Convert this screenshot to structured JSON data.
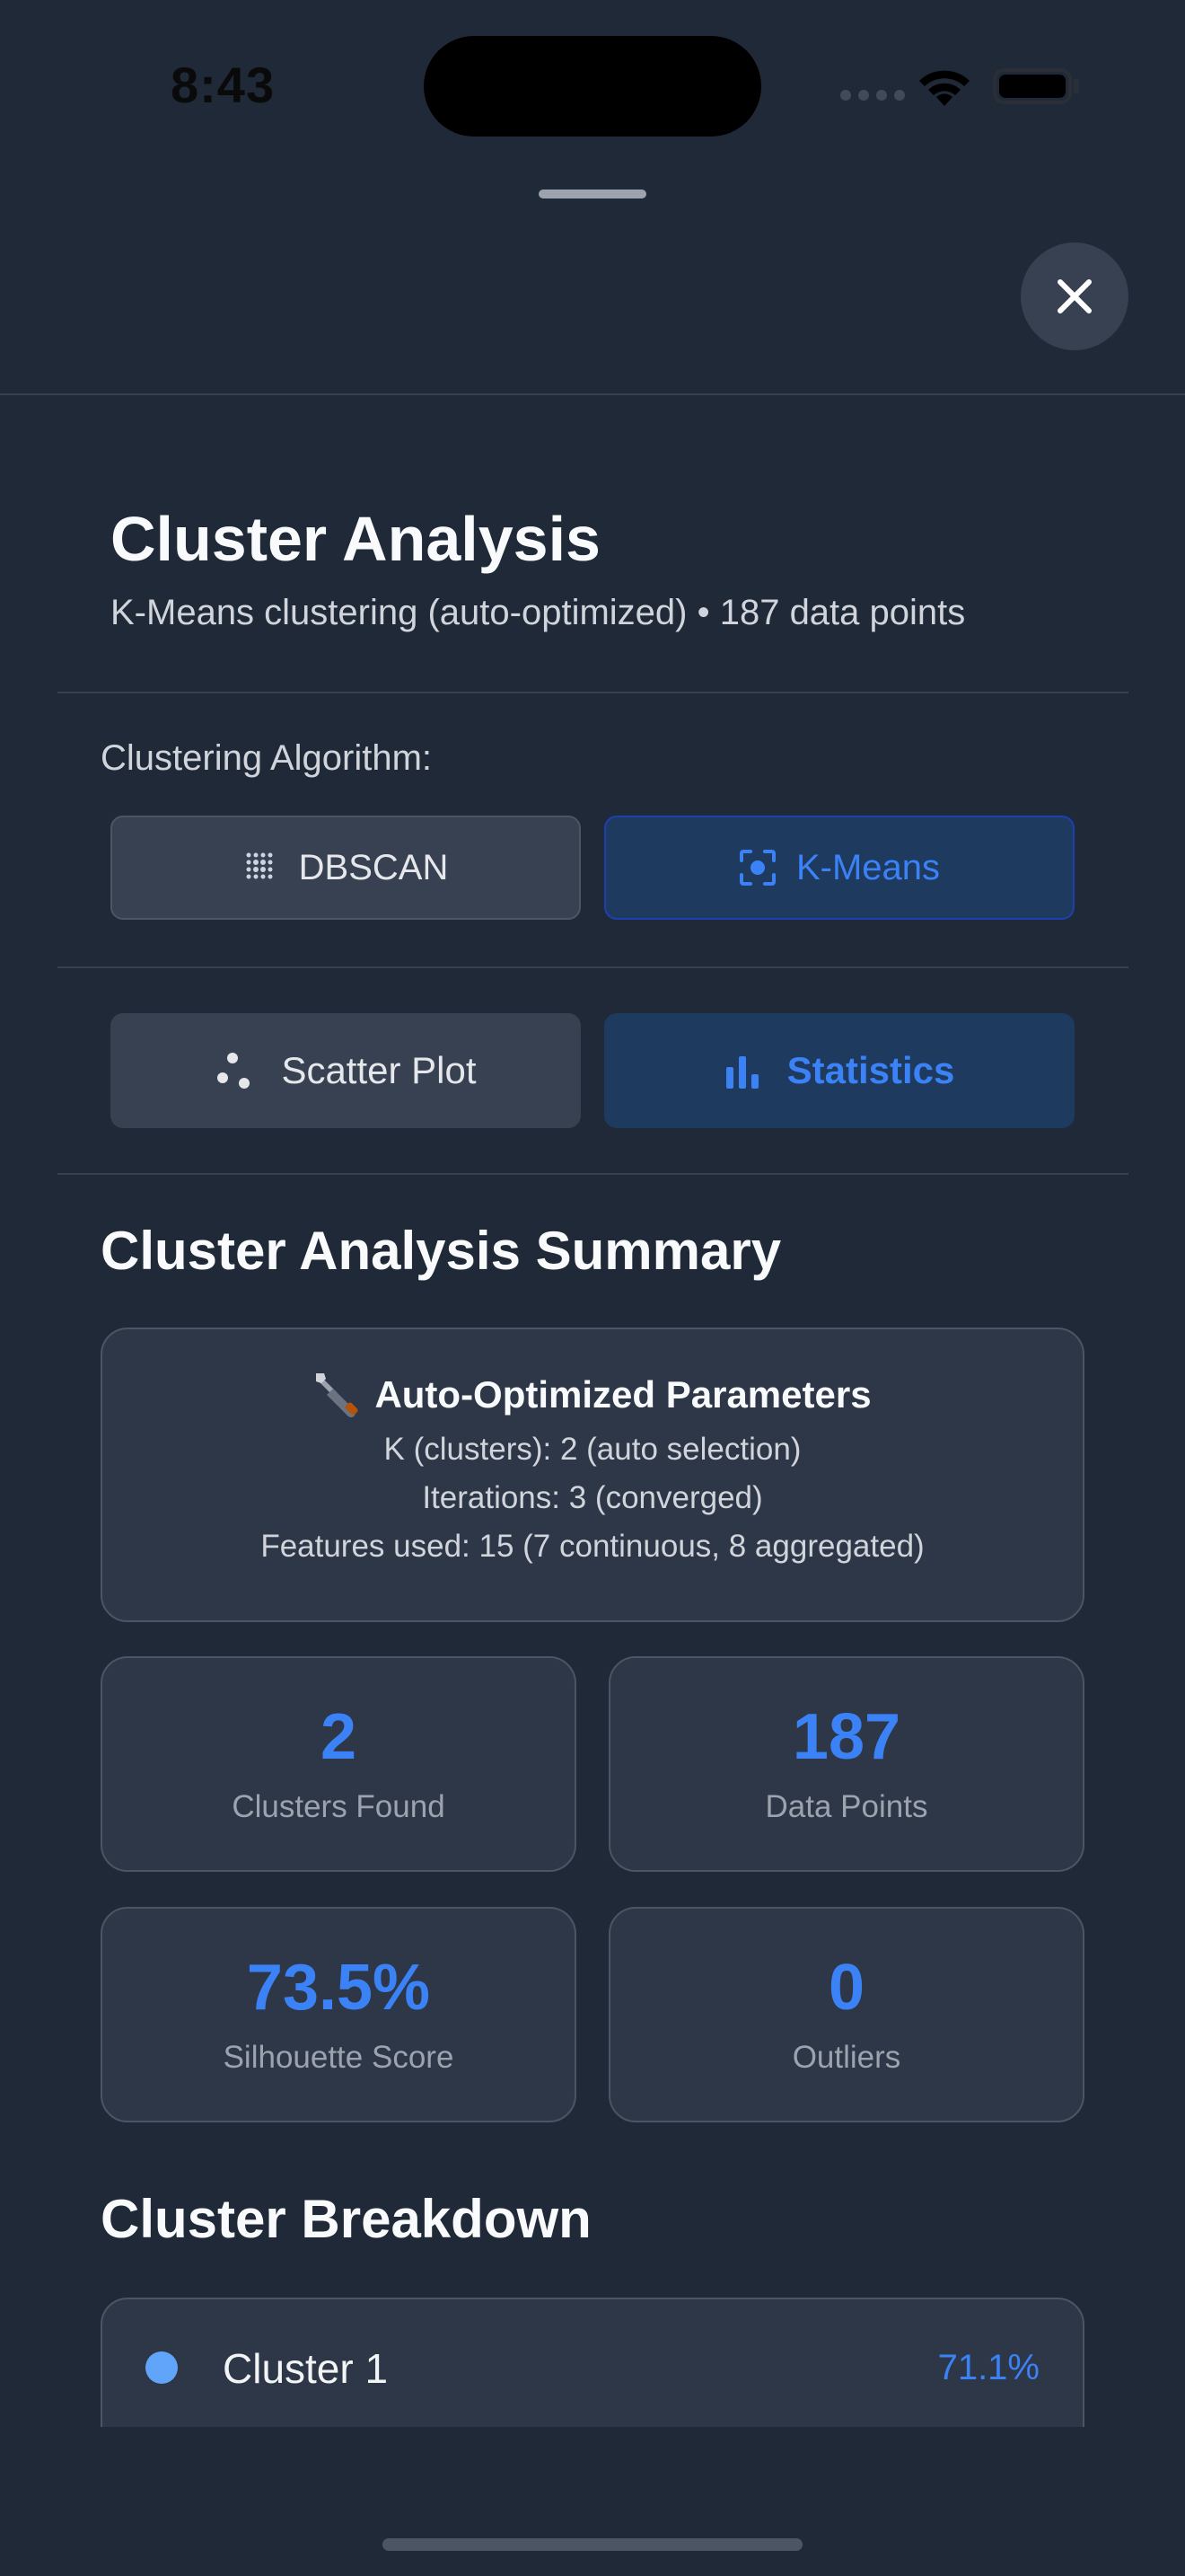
{
  "status_bar": {
    "time": "8:43"
  },
  "header": {
    "close_icon": "close-x-icon"
  },
  "page": {
    "title": "Cluster Analysis",
    "subtitle": "K-Means clustering (auto-optimized) • 187 data points"
  },
  "algorithm": {
    "label": "Clustering Algorithm:",
    "options": [
      {
        "label": "DBSCAN",
        "icon": "dot-grid-icon",
        "selected": false
      },
      {
        "label": "K-Means",
        "icon": "focus-target-icon",
        "selected": true
      }
    ]
  },
  "view_tabs": [
    {
      "label": "Scatter Plot",
      "icon": "scatter-dots-icon",
      "selected": false
    },
    {
      "label": "Statistics",
      "icon": "bar-chart-icon",
      "selected": true
    }
  ],
  "summary": {
    "title": "Cluster Analysis Summary",
    "params": {
      "icon": "wrench-icon",
      "heading": "Auto-Optimized Parameters",
      "lines": [
        "K (clusters): 2 (auto selection)",
        "Iterations: 3 (converged)",
        "Features used: 15 (7 continuous, 8 aggregated)"
      ]
    },
    "stats": [
      {
        "value": "2",
        "label": "Clusters Found"
      },
      {
        "value": "187",
        "label": "Data Points"
      },
      {
        "value": "73.5%",
        "label": "Silhouette Score"
      },
      {
        "value": "0",
        "label": "Outliers"
      }
    ]
  },
  "breakdown": {
    "title": "Cluster Breakdown",
    "clusters": [
      {
        "name": "Cluster 1",
        "percent": "71.1%",
        "color": "#60a5fa"
      }
    ]
  },
  "colors": {
    "background": "#1f2937",
    "card": "#2d3748",
    "accent": "#3b82f6",
    "active_button": "#1e3a5f"
  }
}
